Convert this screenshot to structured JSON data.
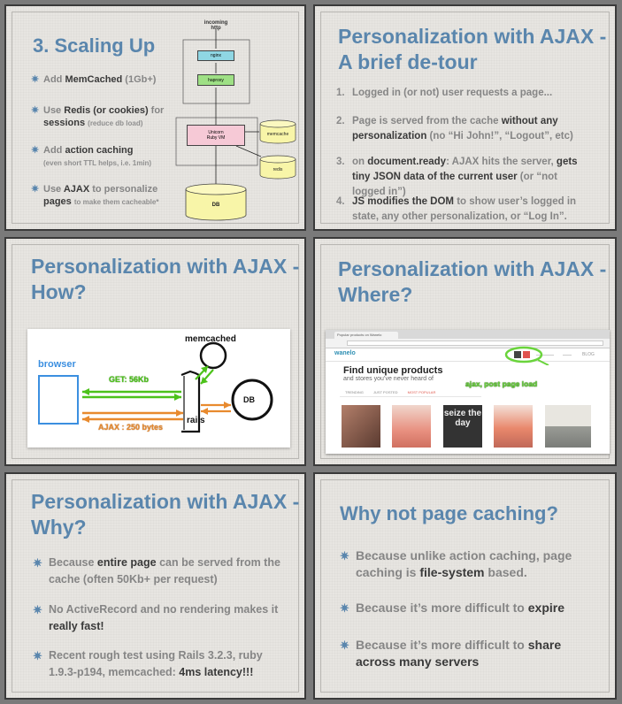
{
  "slide1": {
    "title": "3. Scaling Up",
    "bullets": [
      {
        "pre": "Add ",
        "strong": "MemCached",
        "post": " (1Gb+)",
        "sub": ""
      },
      {
        "pre": "Use ",
        "strong": "Redis (or cookies)",
        "post": " for",
        "line2_strong": "sessions",
        "sub": "(reduce db load)"
      },
      {
        "pre": "Add ",
        "strong": "action caching",
        "post": "",
        "sub": "(even short TTL helps, i.e. 1min)"
      },
      {
        "pre": "Use ",
        "strong": "AJAX",
        "post": " to personalize",
        "line2_strong": "pages",
        "sub": "to make them cacheable*"
      }
    ],
    "diagram": {
      "incoming": "incoming",
      "http": "http",
      "nginx": "nginx",
      "haproxy": "haproxy",
      "unicorn": "Unicorn",
      "rubyvm": "Ruby VM",
      "memcache": "memcache",
      "redis": "redis",
      "db": "DB"
    }
  },
  "slide2": {
    "title_line1": "Personalization with AJAX -",
    "title_line2": "A brief de-tour",
    "items": [
      {
        "n": "1.",
        "parts": [
          [
            "Logged in (or not) user requests a page...",
            "g"
          ]
        ]
      },
      {
        "n": "2.",
        "parts": [
          [
            "Page is served from the cache ",
            "g"
          ],
          [
            "without any personalization",
            "d"
          ],
          [
            " (no “Hi John!”, “Logout”, etc)",
            "g"
          ]
        ]
      },
      {
        "n": "3.",
        "parts": [
          [
            "on ",
            "g"
          ],
          [
            "document.ready",
            "d"
          ],
          [
            ": AJAX hits the server, ",
            "g"
          ],
          [
            "gets tiny JSON data of the current user",
            "d"
          ],
          [
            " (or “not logged in”)",
            "g"
          ]
        ]
      },
      {
        "n": "4.",
        "parts": [
          [
            "JS modifies the DOM",
            "d"
          ],
          [
            " to show user’s logged in state, any other personalization, or “Log In”.",
            "g"
          ]
        ]
      }
    ]
  },
  "slide3": {
    "title_line1": "Personalization with AJAX -",
    "title_line2": "How?",
    "memcached": "memcached",
    "browser": "browser",
    "get": "GET: 56Kb",
    "ajax": "AJAX : 250 bytes",
    "rails": "rails",
    "db": "DB"
  },
  "slide4": {
    "title_line1": "Personalization with AJAX -",
    "title_line2": "Where?",
    "tab_title": "Popular products on Wanelo",
    "logo": "wanelo",
    "blog": "BLOG",
    "headline": "Find unique products",
    "subline": "and stores you’ve never heard of",
    "tabs": [
      "TRENDING",
      "JUST POSTED",
      "MOST POPULAR"
    ],
    "callout": "ajax, post page load",
    "product_text": "seize the day"
  },
  "slide5": {
    "title_line1": "Personalization with AJAX -",
    "title_line2": "Why?",
    "items": [
      {
        "parts": [
          [
            "Because ",
            "g"
          ],
          [
            "entire page",
            "d"
          ],
          [
            " can be served from the cache (often 50Kb+ per request)",
            "g"
          ]
        ]
      },
      {
        "parts": [
          [
            "No ActiveRecord and no rendering makes it ",
            "g"
          ],
          [
            "really fast!",
            "d"
          ]
        ]
      },
      {
        "parts": [
          [
            "Recent rough test using Rails 3.2.3, ruby 1.9.3-p194, memcached: ",
            "g"
          ],
          [
            "4ms latency!!!",
            "d"
          ]
        ]
      }
    ]
  },
  "slide6": {
    "title": "Why not page caching?",
    "items": [
      {
        "parts": [
          [
            "Because unlike action caching, page caching is ",
            "g"
          ],
          [
            "file-system",
            "d"
          ],
          [
            " based.",
            "g"
          ]
        ]
      },
      {
        "parts": [
          [
            "Because it’s more difficult to ",
            "g"
          ],
          [
            "expire",
            "d"
          ]
        ]
      },
      {
        "parts": [
          [
            "Because it’s more difficult to ",
            "g"
          ],
          [
            "share across many servers",
            "d"
          ]
        ]
      }
    ]
  },
  "colors": {
    "title": "#5a86ad",
    "text": "#858585",
    "emphasis": "#3a3a3a",
    "green": "#4cc21a",
    "orange": "#e88a2e",
    "blue": "#3b8fe0"
  }
}
